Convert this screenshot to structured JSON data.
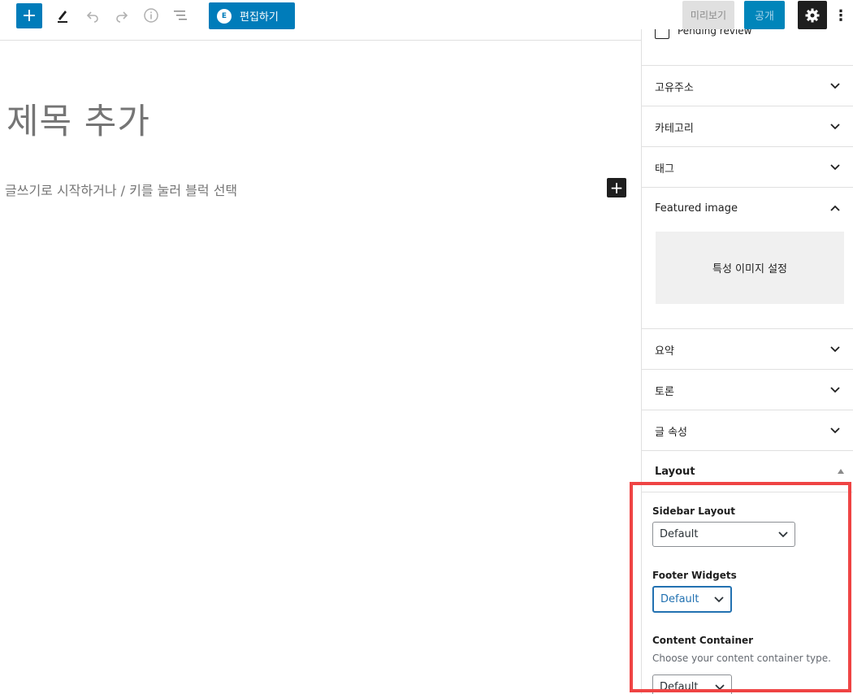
{
  "toolbar": {
    "add_label": "+",
    "elementor_label": "편집하기",
    "elementor_logo": "E",
    "preview_label": "미리보기",
    "publish_label": "공개",
    "more_label": "⋮",
    "accent_color": "#007cba"
  },
  "editor": {
    "title_placeholder": "제목 추가",
    "block_placeholder": "글쓰기로 시작하거나 / 키를 눌러 블럭 선택",
    "inserter_label": "+"
  },
  "sidebar": {
    "pending_review_label": "Pending review",
    "panels": [
      {
        "label": "고유주소",
        "open": false
      },
      {
        "label": "카테고리",
        "open": false
      },
      {
        "label": "태그",
        "open": false
      },
      {
        "label": "Featured image",
        "open": true
      },
      {
        "label": "요약",
        "open": false
      },
      {
        "label": "토론",
        "open": false
      },
      {
        "label": "글 속성",
        "open": false
      }
    ],
    "featured_button_label": "특성 이미지 설정",
    "layout": {
      "title": "Layout",
      "sidebar_layout_label": "Sidebar Layout",
      "sidebar_layout_value": "Default",
      "footer_widgets_label": "Footer Widgets",
      "footer_widgets_value": "Default",
      "content_container_label": "Content Container",
      "content_container_help": "Choose your content container type.",
      "content_container_value": "Default"
    }
  },
  "highlight_color": "#ef4444"
}
